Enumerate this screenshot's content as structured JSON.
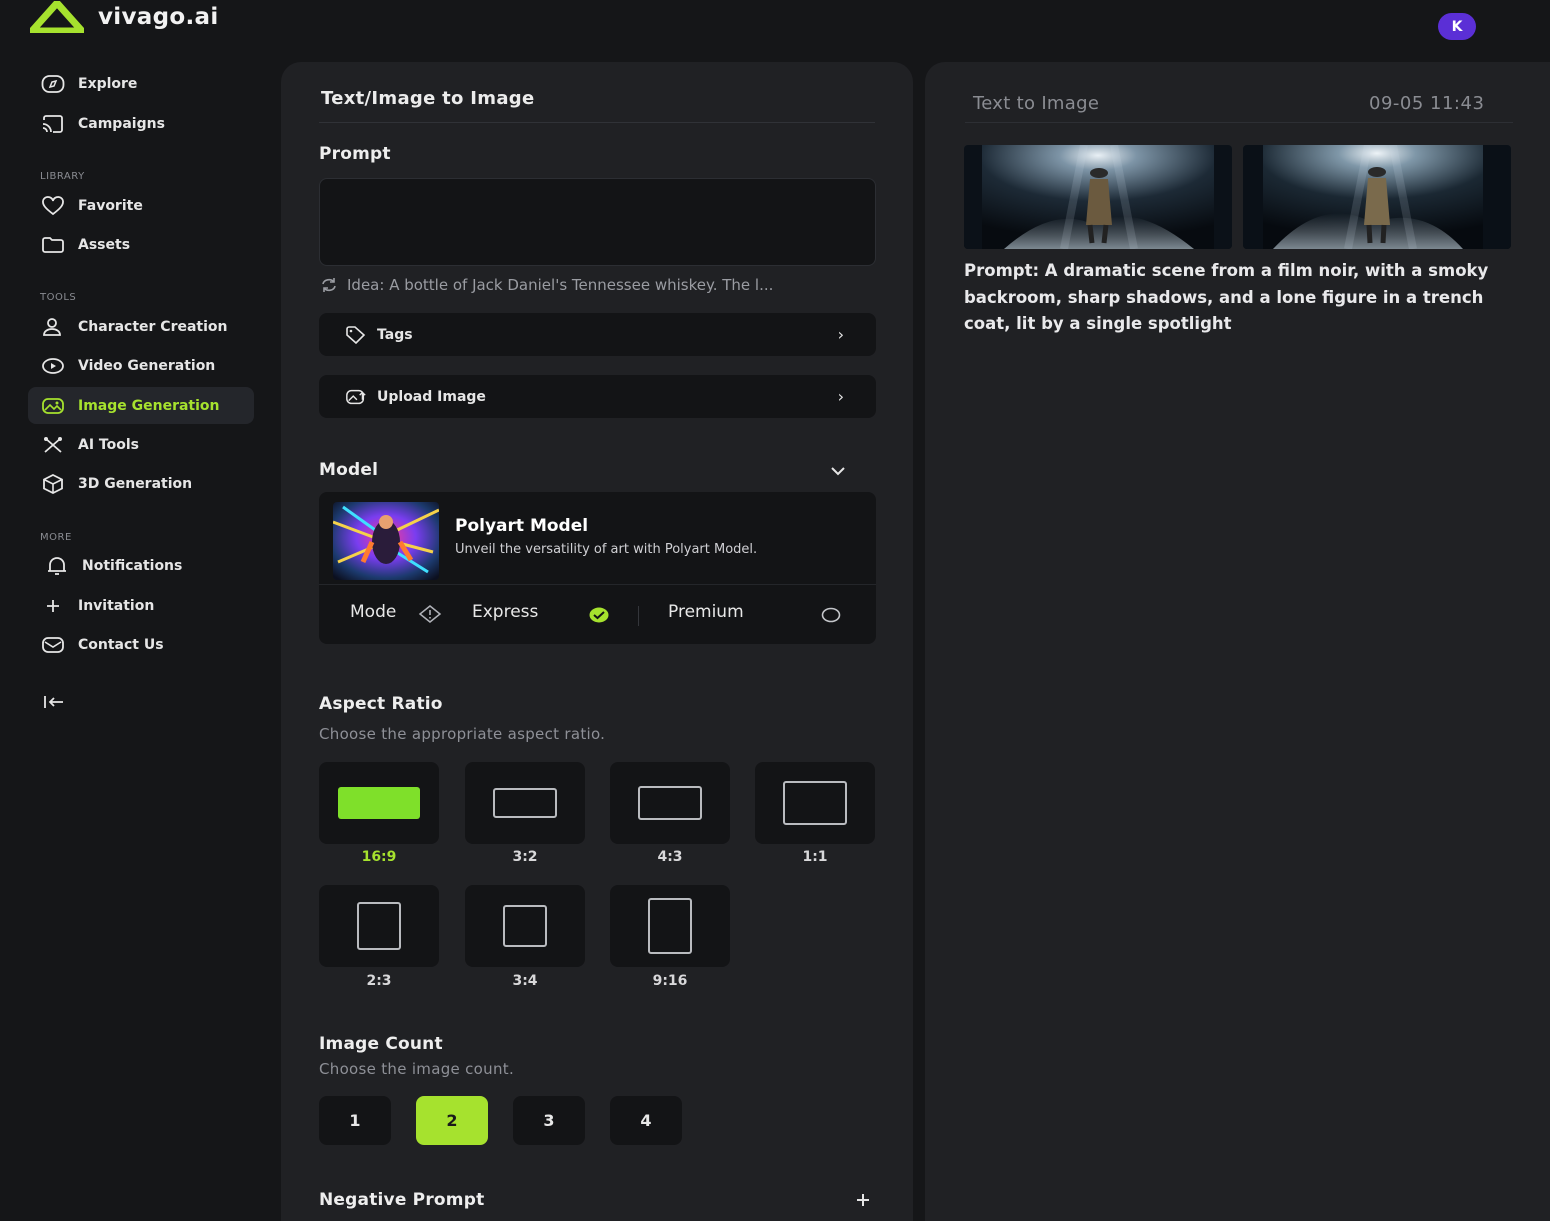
{
  "brand": {
    "name": "vivago.ai",
    "accent": "#a6e22e"
  },
  "user": {
    "initial": "K",
    "avatar_color": "#5b2fd6"
  },
  "sidebar": {
    "items_top": [
      {
        "label": "Explore",
        "icon": "compass-icon"
      },
      {
        "label": "Campaigns",
        "icon": "cast-icon"
      }
    ],
    "library_title": "LIBRARY",
    "library_items": [
      {
        "label": "Favorite",
        "icon": "heart-icon"
      },
      {
        "label": "Assets",
        "icon": "folder-icon"
      }
    ],
    "tools_title": "TOOLS",
    "tools_items": [
      {
        "label": "Character Creation",
        "icon": "user-icon"
      },
      {
        "label": "Video Generation",
        "icon": "video-icon"
      },
      {
        "label": "Image Generation",
        "icon": "image-icon",
        "active": true
      },
      {
        "label": "AI Tools",
        "icon": "tools-icon"
      },
      {
        "label": "3D Generation",
        "icon": "cube-icon"
      }
    ],
    "more_title": "MORE",
    "more_items": [
      {
        "label": "Notifications",
        "icon": "bell-icon"
      },
      {
        "label": "Invitation",
        "icon": "plus-icon"
      },
      {
        "label": "Contact Us",
        "icon": "mail-icon"
      }
    ]
  },
  "form": {
    "title": "Text/Image to Image",
    "prompt_label": "Prompt",
    "prompt_value": "",
    "idea_text": "Idea: A bottle of Jack Daniel's Tennessee whiskey. The l...",
    "tags_label": "Tags",
    "upload_label": "Upload Image",
    "model_label": "Model",
    "model": {
      "name": "Polyart Model",
      "description": "Unveil the versatility of art with Polyart Model.",
      "mode_label": "Mode",
      "express_label": "Express",
      "premium_label": "Premium",
      "selected_mode": "Express"
    },
    "aspect_ratio": {
      "label": "Aspect Ratio",
      "hint": "Choose the appropriate aspect ratio.",
      "options": [
        "16:9",
        "3:2",
        "4:3",
        "1:1",
        "2:3",
        "3:4",
        "9:16"
      ],
      "selected": "16:9"
    },
    "image_count": {
      "label": "Image Count",
      "hint": "Choose the image count.",
      "options": [
        "1",
        "2",
        "3",
        "4"
      ],
      "selected": "2"
    },
    "negative_prompt_label": "Negative Prompt"
  },
  "result": {
    "title": "Text to Image",
    "timestamp": "09-05 11:43",
    "prompt": "Prompt: A dramatic scene from a film noir, with a smoky backroom, sharp shadows, and a lone figure in a trench coat, lit by a single spotlight"
  }
}
